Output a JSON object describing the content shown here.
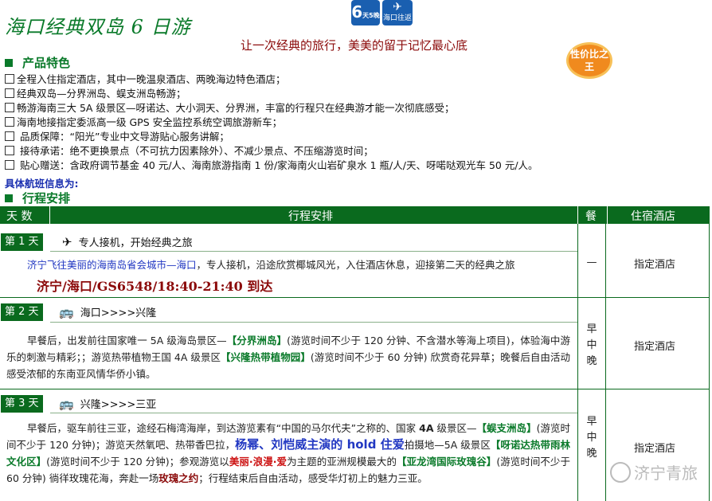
{
  "title": "海口经典双岛 6 日游",
  "badge_days": "6",
  "badge_days_sub": "天5晚",
  "badge_hk": "海口往返",
  "slogan": "让一次经典的旅行，美美的留于记忆最心底",
  "value_badge": "性价比之王",
  "features_heading": "产品特色",
  "features": [
    "全程入住指定酒店，其中一晚温泉酒店、两晚海边特色酒店；",
    "经典双岛—分界洲岛、蜈支洲岛畅游；",
    "畅游海南三大 5A 级景区—呀诺达、大小洞天、分界洲，丰富的行程只在经典游才能一次彻底感受；",
    "海南地接指定委派高一级 GPS 安全监控系统空调旅游新车；",
    " 品质保障：“阳光”专业中文导游贴心服务讲解；",
    " 接待承诺：绝不更换景点（不可抗力因素除外）、不减少景点、不压缩游览时间；",
    " 贴心赠送：含政府调节基金 40 元/人、海南旅游指南 1 份/家海南火山岩矿泉水 1 瓶/人/天、呀喏哒观光车 50 元/人。"
  ],
  "flight_info": "具体航班信息为:",
  "itinerary_heading": "行程安排",
  "table_header": {
    "days": "天 数",
    "schedule": "行程安排",
    "meal": "餐",
    "hotel": "住宿酒店"
  },
  "days": [
    {
      "label": "第 1 天",
      "icon": "airplane-icon",
      "heading": "专人接机，开始经典之旅",
      "body_blue": "济宁飞往美丽的海南岛省会城市—海口",
      "body_rest": "，专人接机，沿途欣赏椰城风光，入住酒店休息，迎接第二天的经典之旅",
      "route": "济宁/海口/GS6548/18:40-21:40 到达",
      "meal": "—",
      "hotel": "指定酒店"
    },
    {
      "label": "第 2 天",
      "icon": "bus-icon",
      "heading": "海口>>>>兴隆",
      "p1": "早餐后，出发前往国家唯一 5A 级海岛景区—",
      "s1": "【分界洲岛】",
      "p2": "(游览时间不少于 120 分钟、不含潜水等海上项目)，体验海中游乐的刺激与精彩；；游览热带植物王国 4A 级景区",
      "s2": "【兴隆热带植物园】",
      "p3": "(游览时间不少于 60 分钟) 欣赏奇花异草；晚餐后自由活动感受浓郁的东南亚风情华侨小镇。",
      "meal": "早中晚",
      "hotel": "指定酒店"
    },
    {
      "label": "第 3 天",
      "icon": "bus-icon",
      "heading": "兴隆>>>>三亚",
      "p1": "早餐后，驱车前往三亚，途经石梅湾海岸，到达游览素有“中国的马尔代夫”之称的、国家 ",
      "b1": "4A",
      "p1b": " 级景区—",
      "s1": "【蜈支洲岛】",
      "p2": "(游览时间不少于 120 分钟)；游览天然氧吧、热带香巴拉，",
      "big": "杨幂、刘恺威主演的 hold 住爱",
      "p3": "拍摄地—5A 级景区",
      "s2": "【呀诺达热带雨林文化区】",
      "p4": "(游览时间不少于 120 分钟)；参观游览以",
      "r1": "美丽·浪漫·爱",
      "p5": "为主题的亚洲规模最大的",
      "s3": "【亚龙湾国际玫瑰谷】",
      "p6": "(游览时间不少于 60 分钟) 徜徉玫瑰花海，奔赴一场",
      "r2": "玫瑰之约",
      "p7": "；行程结束后自由活动，感受华灯初上的魅力三亚。",
      "meal": "早中晚",
      "hotel": "指定酒店"
    }
  ],
  "watermark": "济宁青旅",
  "colors": {
    "green": "#0a6a1e",
    "blue": "#2238c2",
    "red": "#8b0a0a",
    "orange": "#f08a1e"
  }
}
